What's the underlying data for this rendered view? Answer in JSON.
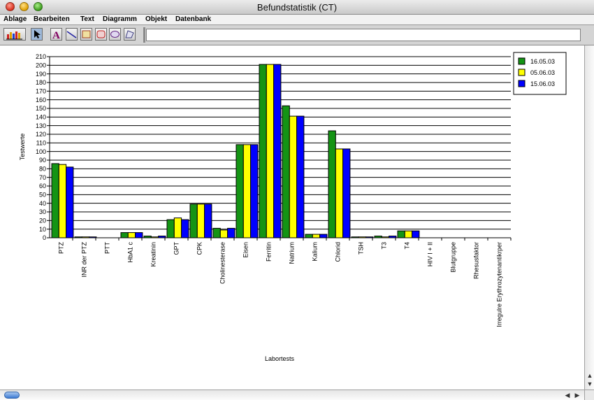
{
  "window": {
    "title": "Befundstatistik (CT)"
  },
  "menu": [
    "Ablage",
    "Bearbeiten",
    "Text",
    "Diagramm",
    "Objekt",
    "Datenbank"
  ],
  "toolbar": {
    "tools": [
      "chart-tool-icon",
      "arrow-pointer-icon",
      "text-tool-icon",
      "line-tool-icon",
      "rectangle-tool-icon",
      "rounded-rectangle-tool-icon",
      "ellipse-tool-icon",
      "polygon-tool-icon"
    ],
    "text_field": ""
  },
  "colors": {
    "series1": "#149414",
    "series2": "#ffff00",
    "series3": "#0000ff"
  },
  "chart_data": {
    "type": "bar",
    "xlabel": "Labortests",
    "ylabel": "Testwerte",
    "ylim": [
      0,
      210
    ],
    "ytick_step": 10,
    "grid": true,
    "legend_position": "top-right",
    "categories": [
      "PTZ",
      "INR der PTZ",
      "PTT",
      "HbA1 c",
      "Kreatinin",
      "GPT",
      "CPK",
      "Cholinesterase",
      "Eisen",
      "Ferritin",
      "Natrium",
      "Kalium",
      "Chlorid",
      "TSH",
      "T3",
      "T4",
      "HIV I + II",
      "Blutgruppe",
      "Rhesusfaktor",
      "Irregulre Erythrozytenantikrper"
    ],
    "series": [
      {
        "name": "16.05.03",
        "color": "#149414",
        "values": [
          86,
          1,
          0,
          6,
          2,
          21,
          39,
          11,
          108,
          201,
          153,
          4,
          124,
          1,
          2,
          8,
          0,
          0,
          0,
          0
        ]
      },
      {
        "name": "05.06.03",
        "color": "#ffff00",
        "values": [
          85,
          1,
          0,
          6,
          1,
          23,
          39,
          9,
          108,
          201,
          141,
          4,
          103,
          1,
          1,
          8,
          0,
          0,
          0,
          0
        ]
      },
      {
        "name": "15.06.03",
        "color": "#0000ff",
        "values": [
          82,
          1,
          0,
          6,
          2,
          21,
          39,
          11,
          108,
          201,
          141,
          4,
          103,
          1,
          2,
          8,
          0,
          0,
          0,
          0
        ]
      }
    ]
  }
}
